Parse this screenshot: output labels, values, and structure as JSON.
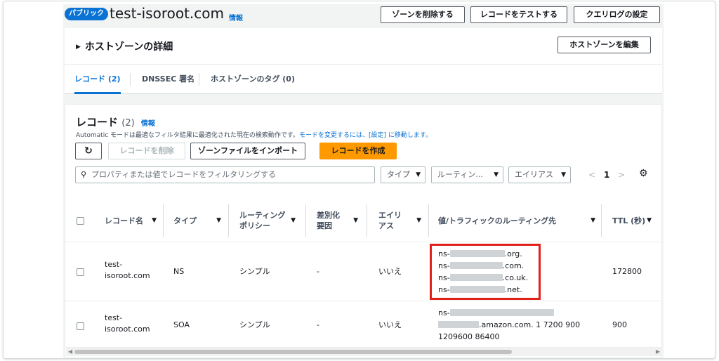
{
  "header": {
    "badge": "パブリック",
    "title": "test-isoroot.com",
    "info": "情報",
    "delete_zone": "ゾーンを削除する",
    "test_record": "レコードをテストする",
    "query_log": "クエリログの設定"
  },
  "details": {
    "title": "ホストゾーンの詳細",
    "edit": "ホストゾーンを編集"
  },
  "tabs": [
    {
      "label": "レコード (2)"
    },
    {
      "label": "DNSSEC 署名"
    },
    {
      "label": "ホストゾーンのタグ (0)"
    }
  ],
  "records": {
    "title": "レコード",
    "count": "(2)",
    "info": "情報",
    "desc_prefix": "Automatic モードは最適なフィルタ結果に最適化された現在の検索動作です。",
    "desc_link": "モードを変更するには、[設定] に移動します。",
    "delete": "レコードを削除",
    "import": "ゾーンファイルをインポート",
    "create": "レコードを作成",
    "filter_placeholder": "プロパティまたは値でレコードをフィルタリングする",
    "filter_type": "タイプ",
    "filter_routing": "ルーティン...",
    "filter_alias": "エイリアス",
    "page": "1"
  },
  "columns": [
    "レコード名",
    "タイプ",
    "ルーティング\nポリシー",
    "差別化\n要因",
    "エイリ\nアス",
    "値/トラフィックのルーティング先",
    "TTL (秒)"
  ],
  "rows": [
    {
      "name_1": "test-",
      "name_2": "isoroot.com",
      "type": "NS",
      "policy": "シンプル",
      "diff": "-",
      "alias": "いいえ",
      "ns1_prefix": "ns-",
      "ns1_suffix": ".org.",
      "ns2_prefix": "ns-",
      "ns2_suffix": ".com.",
      "ns3_prefix": "ns-",
      "ns3_suffix": ".co.uk.",
      "ns4_prefix": "ns-",
      "ns4_suffix": ".net.",
      "ttl": "172800"
    },
    {
      "name_1": "test-",
      "name_2": "isoroot.com",
      "type": "SOA",
      "policy": "シンプル",
      "diff": "-",
      "alias": "いいえ",
      "soa_prefix": "ns-",
      "soa_line2": ".amazon.com. 1 7200 900",
      "soa_line3": "1209600 86400",
      "ttl": "900"
    }
  ]
}
